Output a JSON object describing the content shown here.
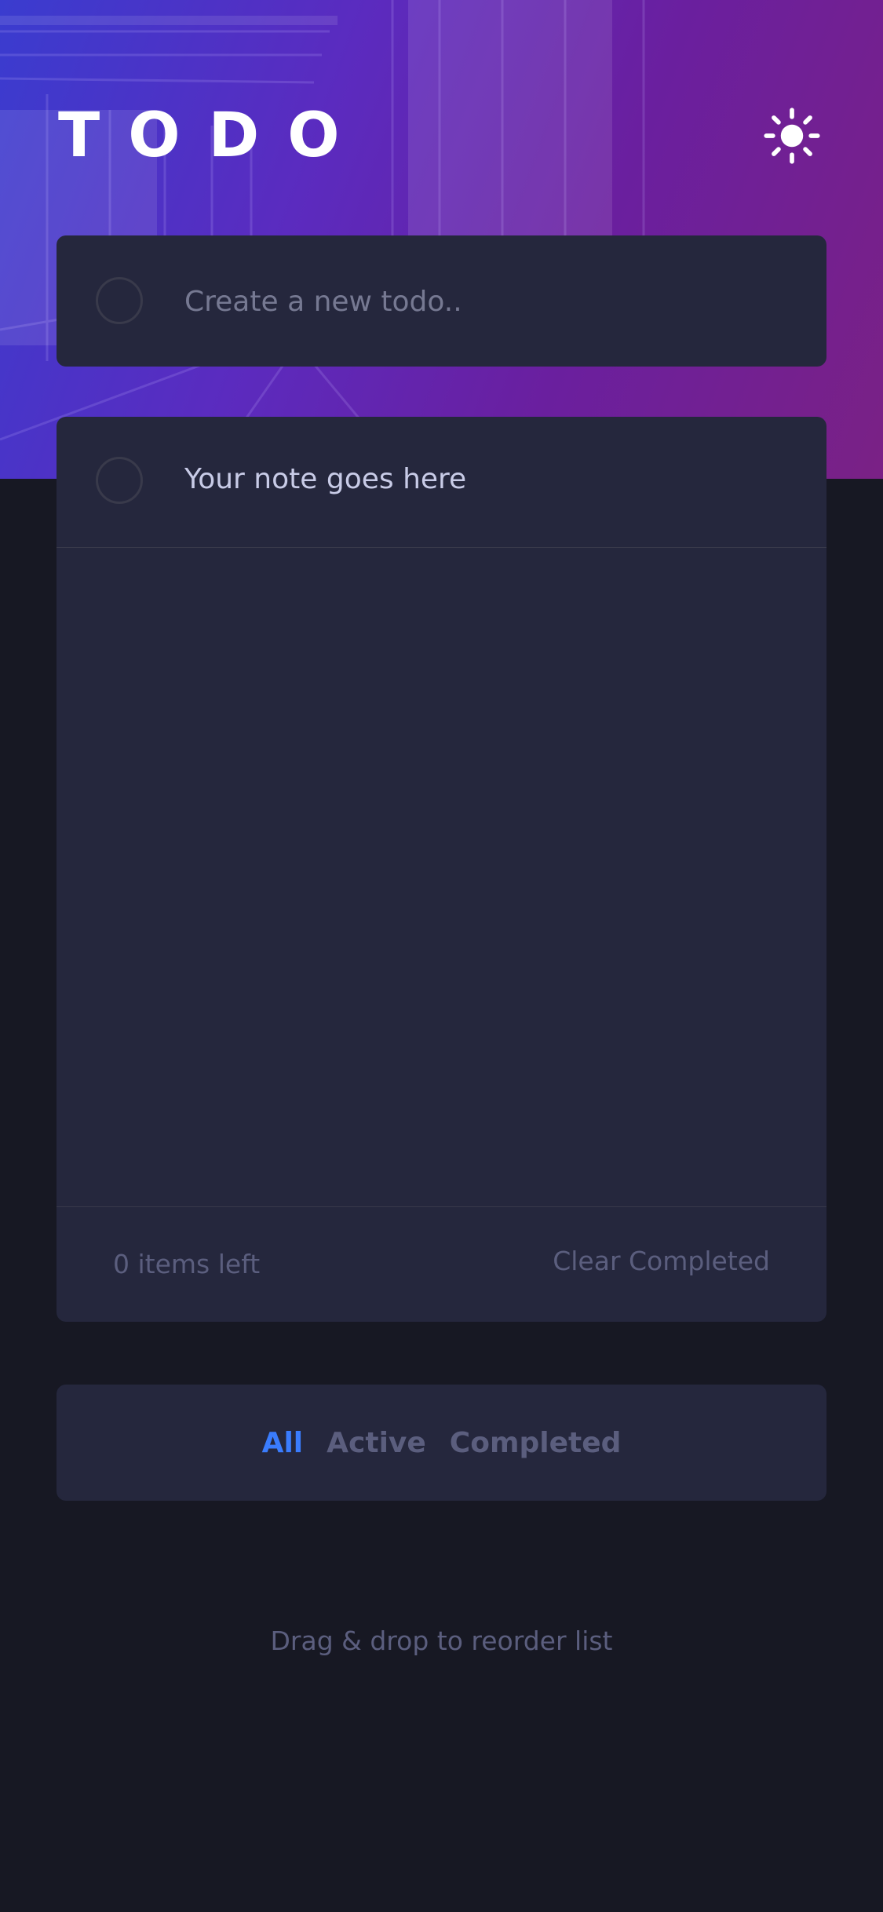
{
  "header": {
    "title": "TODO",
    "theme_toggle_icon": "sun-icon"
  },
  "new_todo": {
    "placeholder": "Create a new todo.."
  },
  "todos": [
    {
      "text": "Your note goes here",
      "completed": false
    }
  ],
  "footer": {
    "items_left": "0 items left",
    "clear_label": "Clear Completed"
  },
  "filters": {
    "all": "All",
    "active": "Active",
    "completed": "Completed",
    "selected": "All"
  },
  "hint": "Drag & drop to reorder list",
  "colors": {
    "background": "#171823",
    "card": "#25273d",
    "accent": "#3a7cfd",
    "muted": "#5b5e7e",
    "text": "#c8cbe7"
  }
}
